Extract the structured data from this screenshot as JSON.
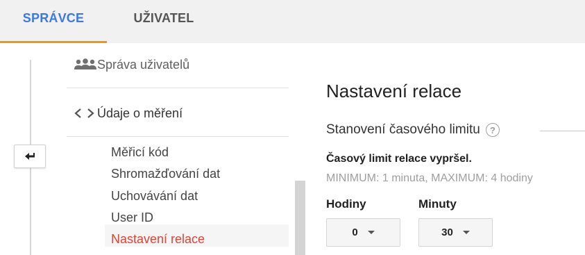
{
  "tabs": {
    "admin": "SPRÁVCE",
    "user": "UŽIVATEL"
  },
  "nav": {
    "user_management": "Správa uživatelů",
    "tracking_info": "Údaje o měření",
    "sub_items": [
      "Měřicí kód",
      "Shromažďování dat",
      "Uchovávání dat",
      "User ID",
      "Nastavení relace"
    ]
  },
  "main": {
    "title": "Nastavení relace",
    "section": "Stanovení časového limitu",
    "help": "?",
    "field_title": "Časový limit relace vypršel.",
    "field_hint": "MINIMUM: 1 minuta, MAXIMUM: 4 hodiny",
    "hours_label": "Hodiny",
    "minutes_label": "Minuty",
    "hours_value": "0",
    "minutes_value": "30"
  },
  "colors": {
    "active_tab": "#3b78e7",
    "tab_underline": "#f29900",
    "active_nav": "#db4437"
  },
  "icons": {
    "back": "back-arrow-icon",
    "users": "people-group-icon",
    "code": "code-brackets-icon",
    "help": "question-circle-icon",
    "dropdown": "chevron-down-icon"
  }
}
